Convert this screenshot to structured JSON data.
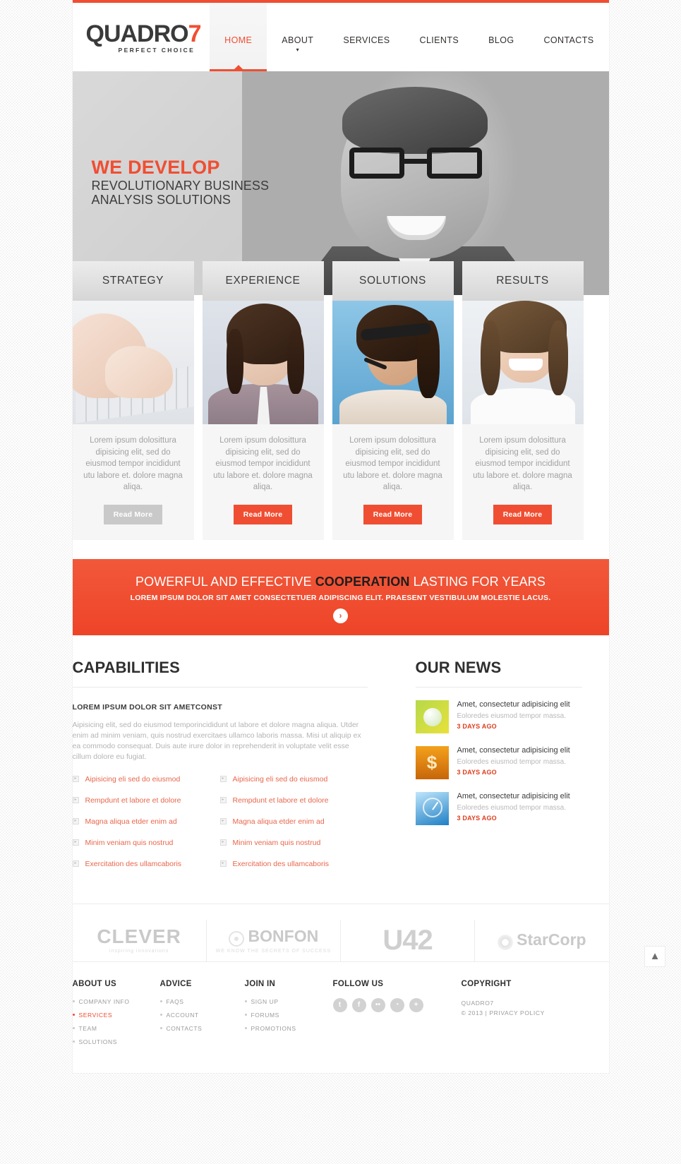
{
  "header": {
    "logo_main": "QUADRO",
    "logo_accent": "7",
    "logo_tagline": "PERFECT CHOICE",
    "accent_color": "#f04e32",
    "nav": [
      {
        "label": "HOME",
        "active": true,
        "has_caret": false
      },
      {
        "label": "ABOUT",
        "active": false,
        "has_caret": true
      },
      {
        "label": "SERVICES",
        "active": false,
        "has_caret": false
      },
      {
        "label": "CLIENTS",
        "active": false,
        "has_caret": false
      },
      {
        "label": "BLOG",
        "active": false,
        "has_caret": false
      },
      {
        "label": "CONTACTS",
        "active": false,
        "has_caret": false
      }
    ]
  },
  "slider": {
    "headline": "WE DEVELOP",
    "subline_1": "REVOLUTIONARY BUSINESS",
    "subline_2": "ANALYSIS SOLUTIONS",
    "slide_count": 3,
    "active_slide": 1
  },
  "cards": [
    {
      "title": "STRATEGY",
      "text": "Lorem ipsum dolosittura dipisicing elit, sed do eiusmod tempor incididunt utu labore et. dolore magna aliqa.",
      "button": "Read More",
      "button_style": "gray",
      "image": "hands-typing-keyboard"
    },
    {
      "title": "EXPERIENCE",
      "text": "Lorem ipsum dolosittura dipisicing elit, sed do eiusmod tempor incididunt utu labore et. dolore magna aliqa.",
      "button": "Read More",
      "button_style": "accent",
      "image": "businesswoman-portrait"
    },
    {
      "title": "SOLUTIONS",
      "text": "Lorem ipsum dolosittura dipisicing elit, sed do eiusmod tempor incididunt utu labore et. dolore magna aliqa.",
      "button": "Read More",
      "button_style": "accent",
      "image": "call-center-agent-headset"
    },
    {
      "title": "RESULTS",
      "text": "Lorem ipsum dolosittura dipisicing elit, sed do eiusmod tempor incididunt utu labore et. dolore magna aliqa.",
      "button": "Read More",
      "button_style": "accent",
      "image": "smiling-woman-portrait"
    }
  ],
  "promo": {
    "title_pre": "POWERFUL AND EFFECTIVE ",
    "title_strong": "COOPERATION",
    "title_post": " LASTING FOR YEARS",
    "subtitle": "LOREM IPSUM DOLOR SIT AMET CONSECTETUER ADIPISCING ELIT. PRAESENT VESTIBULUM MOLESTIE LACUS.",
    "arrow": "›",
    "bg_color": "#f04e32"
  },
  "capabilities": {
    "title": "CAPABILITIES",
    "subtitle": "LOREM IPSUM DOLOR SIT AMETCONST",
    "paragraph": "Aipisicing elit, sed do eiusmod temporincididunt ut labore et dolore magna aliqua. Utder enim ad minim veniam, quis nostrud exercitaes ullamco laboris massa. Misi ut aliquip ex ea commodo consequat. Duis aute irure dolor in reprehenderit in voluptate velit esse cillum dolore eu fugiat.",
    "list_left": [
      "Aipisicing eli sed do eiusmod",
      "Rempdunt et labore et dolore",
      "Magna aliqua etder enim ad",
      "Minim veniam quis nostrud",
      "Exercitation des ullamcaboris"
    ],
    "list_right": [
      "Aipisicing eli sed do eiusmod",
      "Rempdunt et labore et dolore",
      "Magna aliqua etder enim ad",
      "Minim veniam quis nostrud",
      "Exercitation des ullamcaboris"
    ]
  },
  "news": {
    "title": "OUR NEWS",
    "items": [
      {
        "title": "Amet, consectetur adipisicing elit",
        "desc": "Eoloredes eiusmod tempor massa.",
        "date": "3 DAYS AGO",
        "thumb": "green-globe-grass"
      },
      {
        "title": "Amet, consectetur adipisicing elit",
        "desc": "Eoloredes eiusmod tempor massa.",
        "date": "3 DAYS AGO",
        "thumb": "golden-dollar-sign"
      },
      {
        "title": "Amet, consectetur adipisicing elit",
        "desc": "Eoloredes eiusmod tempor massa.",
        "date": "3 DAYS AGO",
        "thumb": "blue-clock"
      }
    ]
  },
  "partners": [
    {
      "name": "CLEVER",
      "tagline": "inspiring innovations"
    },
    {
      "name": "BONFON",
      "tagline": "WE KNOW THE SECRETS OF SUCCESS"
    },
    {
      "name": "U42",
      "tagline": ""
    },
    {
      "name": "StarCorp",
      "tagline": ""
    }
  ],
  "footer": {
    "columns": [
      {
        "title": "ABOUT US",
        "items": [
          {
            "label": "COMPANY INFO",
            "active": false
          },
          {
            "label": "SERVICES",
            "active": true
          },
          {
            "label": "TEAM",
            "active": false
          },
          {
            "label": "SOLUTIONS",
            "active": false
          }
        ]
      },
      {
        "title": "ADVICE",
        "items": [
          {
            "label": "FAQS",
            "active": false
          },
          {
            "label": "ACCOUNT",
            "active": false
          },
          {
            "label": "CONTACTS",
            "active": false
          }
        ]
      },
      {
        "title": "JOIN IN",
        "items": [
          {
            "label": "SIGN UP",
            "active": false
          },
          {
            "label": "FORUMS",
            "active": false
          },
          {
            "label": "PROMOTIONS",
            "active": false
          }
        ]
      },
      {
        "title": "FOLLOW US",
        "items": []
      },
      {
        "title": "COPYRIGHT",
        "items": []
      }
    ],
    "socials": [
      {
        "name": "twitter-icon",
        "glyph": "t"
      },
      {
        "name": "facebook-icon",
        "glyph": "f"
      },
      {
        "name": "flickr-icon",
        "glyph": "••"
      },
      {
        "name": "rss-icon",
        "glyph": "◔"
      },
      {
        "name": "plus-icon",
        "glyph": "+"
      }
    ],
    "copyright_line1": "QUADRO7",
    "copyright_line2": "© 2013 | PRIVACY POLICY",
    "to_top_icon": "▲"
  }
}
